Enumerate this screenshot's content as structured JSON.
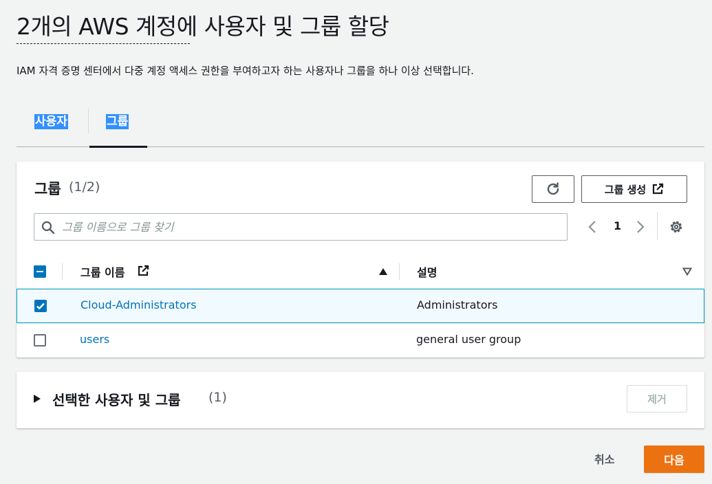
{
  "page": {
    "title": "2개의 AWS 계정에 사용자 및 그룹 할당",
    "description": "IAM 자격 증명 센터에서 다중 계정 액세스 권한을 부여하고자 하는 사용자나 그룹을 하나 이상 선택합니다."
  },
  "tabs": [
    {
      "label": "사용자",
      "active": false
    },
    {
      "label": "그룹",
      "active": true
    }
  ],
  "groups_panel": {
    "title": "그룹",
    "count": "(1/2)",
    "create_button": "그룹 생성",
    "search_placeholder": "그룹 이름으로 그룹 찾기",
    "page_number": "1",
    "columns": {
      "name": "그룹 이름",
      "description": "설명"
    },
    "rows": [
      {
        "name": "Cloud-Administrators",
        "description": "Administrators",
        "selected": true
      },
      {
        "name": "users",
        "description": "general user group",
        "selected": false
      }
    ]
  },
  "selected_panel": {
    "title": "선택한 사용자 및 그룹",
    "count": "(1)",
    "remove_button": "제거"
  },
  "footer": {
    "cancel": "취소",
    "next": "다음"
  },
  "colors": {
    "primary": "#ec7211",
    "link": "#0073bb",
    "selected_row_bg": "#f1faff",
    "selected_row_border": "#00a1c9"
  }
}
